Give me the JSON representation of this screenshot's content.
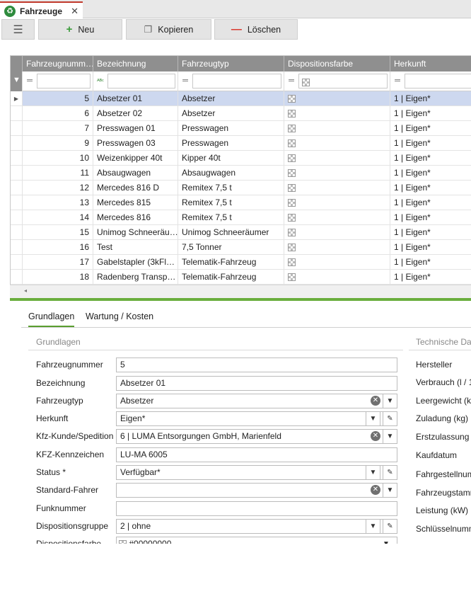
{
  "window": {
    "tab_label": "Fahrzeuge",
    "close_symbol": "✕",
    "app_icon": "recycle-icon"
  },
  "toolbar": {
    "new_label": "Neu",
    "copy_label": "Kopieren",
    "delete_label": "Löschen",
    "menu_icon": "hamburger-icon"
  },
  "colors": {
    "accent_red": "#c0392b",
    "header_gray": "#8f8f8f",
    "selected_row": "#cdd8ef",
    "green_bar": "#6aae3e"
  },
  "grid": {
    "columns": [
      "Fahrzeugnumm…",
      "Bezeichnung",
      "Fahrzeugtyp",
      "Dispositionsfarbe",
      "Herkunft"
    ],
    "rows": [
      {
        "nr": "5",
        "bez": "Absetzer 01",
        "typ": "Absetzer",
        "herkunft": "1 | Eigen*"
      },
      {
        "nr": "6",
        "bez": "Absetzer 02",
        "typ": "Absetzer",
        "herkunft": "1 | Eigen*"
      },
      {
        "nr": "7",
        "bez": "Presswagen 01",
        "typ": "Presswagen",
        "herkunft": "1 | Eigen*"
      },
      {
        "nr": "9",
        "bez": "Presswagen 03",
        "typ": "Presswagen",
        "herkunft": "1 | Eigen*"
      },
      {
        "nr": "10",
        "bez": "Weizenkipper 40t",
        "typ": "Kipper 40t",
        "herkunft": "1 | Eigen*"
      },
      {
        "nr": "11",
        "bez": "Absaugwagen",
        "typ": "Absaugwagen",
        "herkunft": "1 | Eigen*"
      },
      {
        "nr": "12",
        "bez": "Mercedes 816 D",
        "typ": "Remitex 7,5 t",
        "herkunft": "1 | Eigen*"
      },
      {
        "nr": "13",
        "bez": "Mercedes 815",
        "typ": "Remitex 7,5 t",
        "herkunft": "1 | Eigen*"
      },
      {
        "nr": "14",
        "bez": "Mercedes 816",
        "typ": "Remitex 7,5 t",
        "herkunft": "1 | Eigen*"
      },
      {
        "nr": "15",
        "bez": "Unimog Schneeräu…",
        "typ": "Unimog Schneeräumer",
        "herkunft": "1 | Eigen*"
      },
      {
        "nr": "16",
        "bez": "Test",
        "typ": "7,5 Tonner",
        "herkunft": "1 | Eigen*"
      },
      {
        "nr": "17",
        "bez": "Gabelstapler (3kFl…",
        "typ": "Telematik-Fahrzeug",
        "herkunft": "1 | Eigen*"
      },
      {
        "nr": "18",
        "bez": "Radenberg Transp…",
        "typ": "Telematik-Fahrzeug",
        "herkunft": "1 | Eigen*"
      }
    ],
    "selected_index": 0
  },
  "form_tabs": [
    "Grundlagen",
    "Wartung / Kosten"
  ],
  "form": {
    "section_left": "Grundlagen",
    "section_right": "Technische Da",
    "fields": [
      {
        "label": "Fahrzeugnummer",
        "value": "5"
      },
      {
        "label": "Bezeichnung",
        "value": "Absetzer 01"
      },
      {
        "label": "Fahrzeugtyp",
        "value": "Absetzer"
      },
      {
        "label": "Herkunft",
        "value": "Eigen*"
      },
      {
        "label": "Kfz-Kunde/Spedition",
        "value": "6 | LUMA Entsorgungen GmbH, Marienfeld"
      },
      {
        "label": "KFZ-Kennzeichen",
        "value": "LU-MA 6005"
      },
      {
        "label": "Status *",
        "value": "Verfügbar*"
      },
      {
        "label": "Standard-Fahrer",
        "value": ""
      },
      {
        "label": "Funknummer",
        "value": ""
      },
      {
        "label": "Dispositionsgruppe",
        "value": "2 | ohne"
      },
      {
        "label": "Dispositionsfarbe",
        "value": "#00000000"
      }
    ],
    "right_labels": [
      "Hersteller",
      "Verbrauch (l / 1",
      "Leergewicht (k",
      "Zuladung (kg)",
      "Erstzulassung",
      "Kaufdatum",
      "Fahrgestellnum",
      "Fahrzeugstamm",
      "Leistung (kW)",
      "Schlüsselnumm"
    ]
  }
}
